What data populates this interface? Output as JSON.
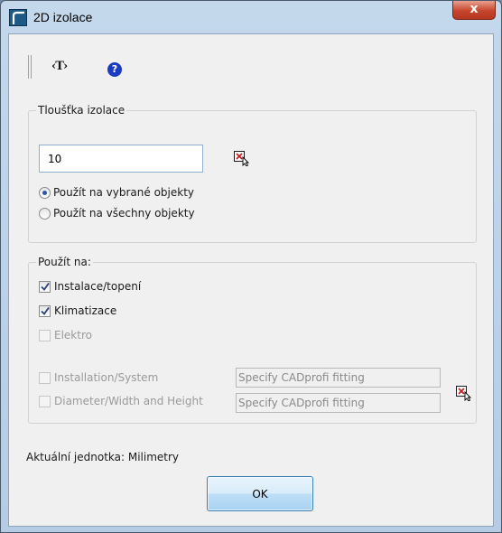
{
  "window": {
    "title": "2D izolace",
    "close_label": "x"
  },
  "toolbar": {
    "text_tool_label": "‹T›",
    "help_label": "?"
  },
  "thickness_group": {
    "legend": "Tloušťka izolace",
    "value": "10",
    "options": [
      {
        "label": "Použít na vybrané objekty",
        "checked": true
      },
      {
        "label": "Použít na všechny objekty",
        "checked": false
      }
    ]
  },
  "apply_group": {
    "legend": "Použít na:",
    "items": [
      {
        "label": "Instalace/topení",
        "checked": true,
        "enabled": true
      },
      {
        "label": "Klimatizace",
        "checked": true,
        "enabled": true
      },
      {
        "label": "Elektro",
        "checked": false,
        "enabled": false
      }
    ],
    "fitting_rows": [
      {
        "label": "Installation/System",
        "checked": false,
        "enabled": false,
        "value": "Specify CADprofi fitting"
      },
      {
        "label": "Diameter/Width and Height",
        "checked": false,
        "enabled": false,
        "value": "Specify CADprofi fitting"
      }
    ]
  },
  "unit_label": "Aktuální jednotka: Milimetry",
  "ok_label": "OK"
}
